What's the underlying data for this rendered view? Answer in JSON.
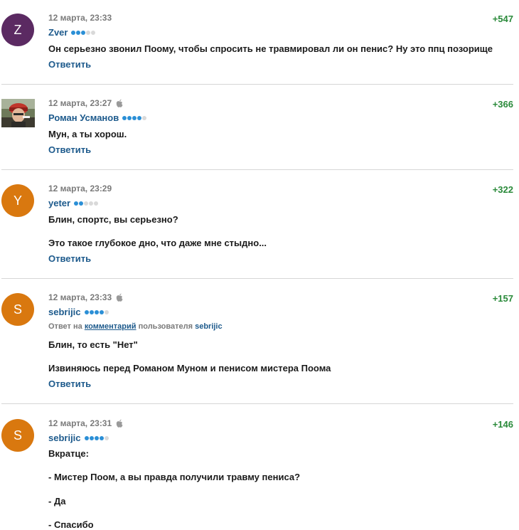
{
  "comments": [
    {
      "avatar_letter": "Z",
      "avatar_color": "#5b2a62",
      "timestamp": "12 марта, 23:33",
      "author": "Zver",
      "rating_dots": 3,
      "score": "+547",
      "lines": [
        "Он серьезно звонил Поому, чтобы спросить не травмировал ли он пенис? Ну это ппц позорище"
      ],
      "reply_label": "Ответить"
    },
    {
      "avatar_icon": "photo-avatar",
      "timestamp": "12 марта, 23:27",
      "author": "Роман Усманов",
      "rating_dots": 4,
      "score": "+366",
      "lines": [
        "Мун, а ты хорош."
      ],
      "reply_label": "Ответить"
    },
    {
      "avatar_letter": "Y",
      "avatar_color": "#d9780f",
      "timestamp": "12 марта, 23:29",
      "author": "yeter",
      "rating_dots": 2,
      "score": "+322",
      "lines": [
        "Блин, спортс, вы серьезно?",
        "Это такое глубокое дно, что даже мне стыдно..."
      ],
      "reply_label": "Ответить"
    },
    {
      "avatar_letter": "S",
      "avatar_color": "#d9780f",
      "timestamp": "12 марта, 23:33",
      "author": "sebrijic",
      "rating_dots": 4,
      "score": "+157",
      "reply_to": {
        "prefix": "Ответ на",
        "link": "комментарий",
        "middle": "пользователя",
        "user": "sebrijic"
      },
      "lines": [
        "Блин, то есть \"Нет\"",
        "Извиняюсь перед Романом Муном и пенисом мистера Поома"
      ],
      "reply_label": "Ответить"
    },
    {
      "avatar_letter": "S",
      "avatar_color": "#d9780f",
      "timestamp": "12 марта, 23:31",
      "author": "sebrijic",
      "rating_dots": 4,
      "score": "+146",
      "lines": [
        "Вкратце:",
        "- Мистер Поом, а вы правда получили травму пениса?",
        "- Да",
        "- Спасибо"
      ]
    }
  ],
  "colors": {
    "author": "#1d5a8c",
    "score": "#2a8a3a",
    "meta": "#7a7a7a",
    "dot_on": "#2b8fd6",
    "dot_off": "#d9d9d9"
  }
}
